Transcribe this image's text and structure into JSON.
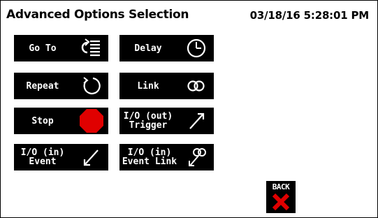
{
  "header": {
    "title": "Advanced Options Selection",
    "datetime": "03/18/16 5:28:01 PM"
  },
  "buttons": {
    "goto": {
      "label": "Go To",
      "icon": "goto-list-icon"
    },
    "delay": {
      "label": "Delay",
      "icon": "clock-icon"
    },
    "repeat": {
      "label": "Repeat",
      "icon": "repeat-circle-icon"
    },
    "link": {
      "label": "Link",
      "icon": "link-rings-icon"
    },
    "stop": {
      "label": "Stop",
      "icon": "stop-octagon-icon"
    },
    "io_out_trigger": {
      "line1": "I/O (out)",
      "line2": "Trigger",
      "icon": "arrow-up-right-icon"
    },
    "io_in_event": {
      "line1": "I/O (in)",
      "line2": "Event",
      "icon": "arrow-down-left-icon"
    },
    "io_in_event_link": {
      "line1": "I/O (in)",
      "line2": "Event Link",
      "icon": "link-arrow-down-left-icon"
    }
  },
  "back": {
    "label": "BACK",
    "icon": "x-icon",
    "icon_color": "#e00000"
  },
  "colors": {
    "button_bg": "#000000",
    "button_text": "#ffffff",
    "stop_red": "#e00000"
  }
}
